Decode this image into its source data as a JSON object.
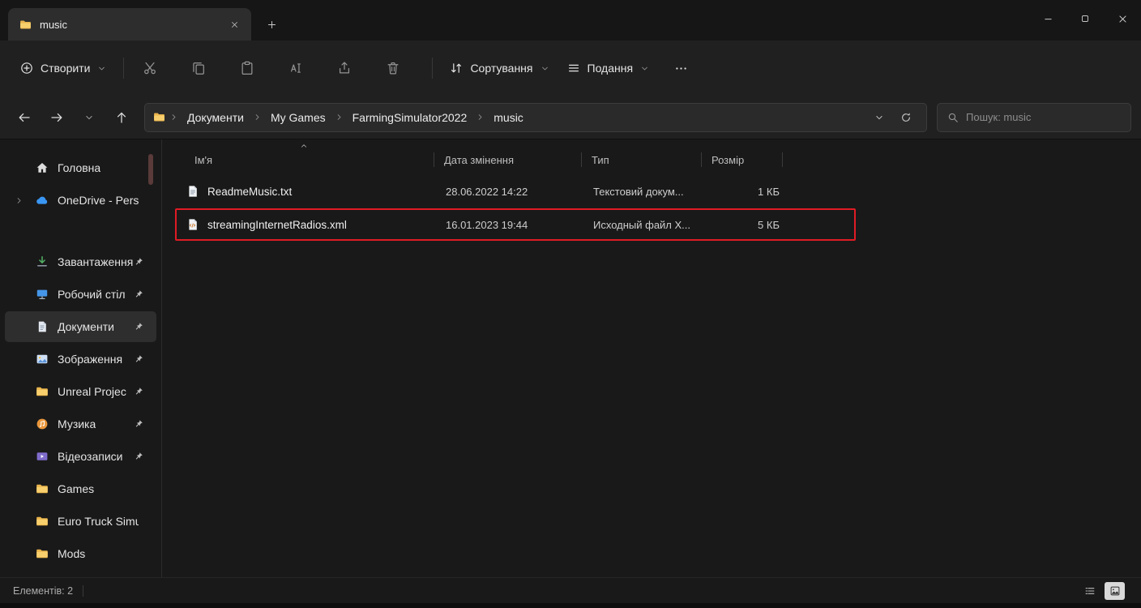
{
  "titlebar": {
    "tab_title": "music"
  },
  "toolbar": {
    "new_button": {
      "label": "Створити",
      "icon": "plus-circle"
    },
    "file_buttons": [
      {
        "name": "cut-button",
        "icon": "cut"
      },
      {
        "name": "copy-button",
        "icon": "copy"
      },
      {
        "name": "paste-button",
        "icon": "paste"
      },
      {
        "name": "rename-button",
        "icon": "rename"
      },
      {
        "name": "share-button",
        "icon": "share"
      },
      {
        "name": "delete-button",
        "icon": "delete"
      }
    ],
    "sort_button": {
      "label": "Сортування",
      "icon": "sort"
    },
    "view_button": {
      "label": "Подання",
      "icon": "view"
    },
    "more_button": {
      "name": "see-more-button",
      "icon": "more"
    }
  },
  "addressbar": {
    "breadcrumbs": [
      {
        "label": "Документи"
      },
      {
        "label": "My Games"
      },
      {
        "label": "FarmingSimulator2022"
      },
      {
        "label": "music"
      }
    ]
  },
  "search": {
    "placeholder": "Пошук: music"
  },
  "sidebar": {
    "items": [
      {
        "name": "sidebar-item-home",
        "label": "Головна",
        "icon": "home",
        "pinned": false,
        "selected": false,
        "expandable": false,
        "spacer_before": false
      },
      {
        "name": "sidebar-item-onedrive",
        "label": "OneDrive - Perso",
        "icon": "cloud",
        "pinned": false,
        "selected": false,
        "expandable": true,
        "spacer_before": false
      },
      {
        "name": "sidebar-item-downloads",
        "label": "Завантаження",
        "icon": "download",
        "pinned": true,
        "selected": false,
        "expandable": false,
        "spacer_before": true
      },
      {
        "name": "sidebar-item-desktop",
        "label": "Робочий стіл",
        "icon": "desktop",
        "pinned": true,
        "selected": false,
        "expandable": false,
        "spacer_before": false
      },
      {
        "name": "sidebar-item-documents",
        "label": "Документи",
        "icon": "documents",
        "pinned": true,
        "selected": true,
        "expandable": false,
        "spacer_before": false
      },
      {
        "name": "sidebar-item-pictures",
        "label": "Зображення",
        "icon": "picture",
        "pinned": true,
        "selected": false,
        "expandable": false,
        "spacer_before": false
      },
      {
        "name": "sidebar-item-unreal-projects",
        "label": "Unreal Projec",
        "icon": "folder",
        "pinned": true,
        "selected": false,
        "expandable": false,
        "spacer_before": false
      },
      {
        "name": "sidebar-item-music",
        "label": "Музика",
        "icon": "music",
        "pinned": true,
        "selected": false,
        "expandable": false,
        "spacer_before": false
      },
      {
        "name": "sidebar-item-videos",
        "label": "Відеозаписи",
        "icon": "video",
        "pinned": true,
        "selected": false,
        "expandable": false,
        "spacer_before": false
      },
      {
        "name": "sidebar-item-games",
        "label": "Games",
        "icon": "folder",
        "pinned": false,
        "selected": false,
        "expandable": false,
        "spacer_before": false
      },
      {
        "name": "sidebar-item-euro-truck",
        "label": "Euro Truck Simu",
        "icon": "folder",
        "pinned": false,
        "selected": false,
        "expandable": false,
        "spacer_before": false
      },
      {
        "name": "sidebar-item-mods",
        "label": "Mods",
        "icon": "folder",
        "pinned": false,
        "selected": false,
        "expandable": false,
        "spacer_before": false
      }
    ]
  },
  "filelist": {
    "columns": [
      {
        "label": "Ім'я"
      },
      {
        "label": "Дата змінення"
      },
      {
        "label": "Тип"
      },
      {
        "label": "Розмір"
      }
    ],
    "rows": [
      {
        "name": "ReadmeMusic.txt",
        "icon": "file-txt",
        "date": "28.06.2022 14:22",
        "type": "Текстовий докум...",
        "size": "1 КБ",
        "annotated": false
      },
      {
        "name": "streamingInternetRadios.xml",
        "icon": "file-xml",
        "date": "16.01.2023 19:44",
        "type": "Исходный файл X...",
        "size": "5 КБ",
        "annotated": true
      }
    ]
  },
  "statusbar": {
    "items_count": "Елементів: 2"
  },
  "colors": {
    "annotation_box": "#e01b24"
  }
}
